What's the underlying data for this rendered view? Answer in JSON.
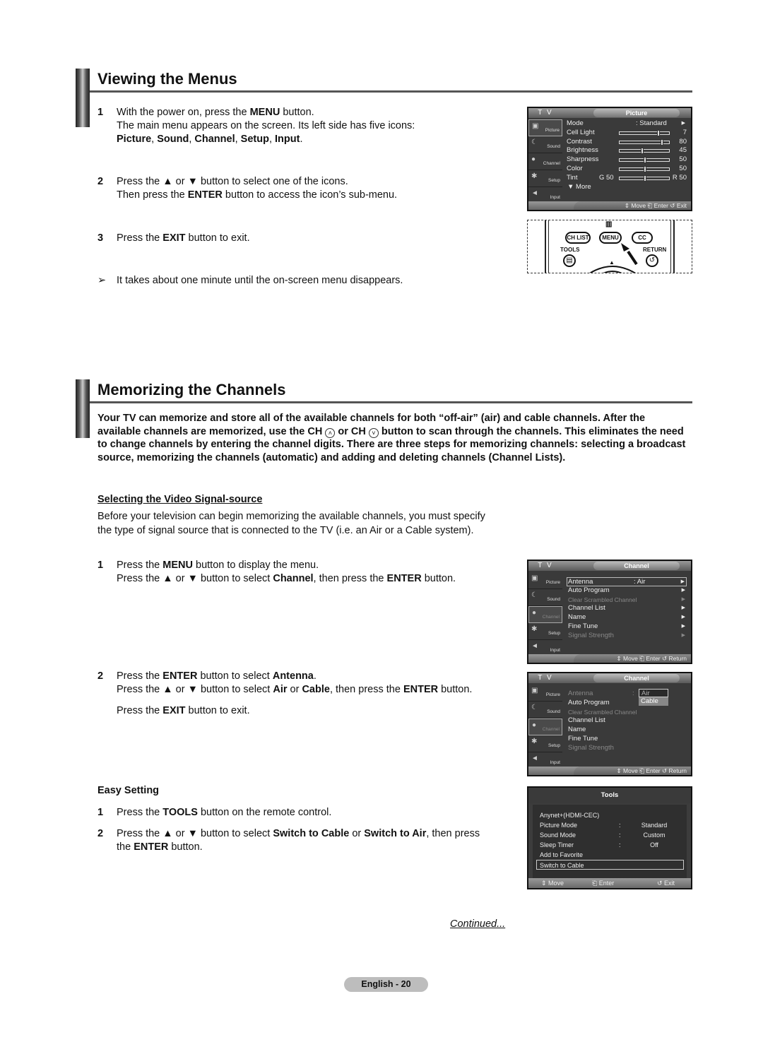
{
  "section1": {
    "title": "Viewing the Menus",
    "steps": [
      {
        "num": "1",
        "line1_pre": "With the power on, press the ",
        "line1_bold": "MENU",
        "line1_post": " button.",
        "line2": "The main menu appears on the screen. Its left side has five icons:",
        "line3_parts": [
          "Picture",
          ", ",
          "Sound",
          ", ",
          "Channel",
          ", ",
          "Setup",
          ", ",
          "Input",
          "."
        ]
      },
      {
        "num": "2",
        "line1": "Press the ▲ or ▼ button to select one of the icons.",
        "line2_pre": "Then press the ",
        "line2_bold": "ENTER",
        "line2_post": " button to access the icon’s sub-menu."
      },
      {
        "num": "3",
        "line1_pre": "Press the ",
        "line1_bold": "EXIT",
        "line1_post": " button to exit."
      }
    ],
    "note_icon": "➢",
    "note": "It takes about one minute until the on-screen menu disappears."
  },
  "picture_osd": {
    "tv_label": "T V",
    "header": "Picture",
    "sidebar": [
      "Picture",
      "Sound",
      "Channel",
      "Setup",
      "Input"
    ],
    "sidebar_icons": [
      "▣",
      "☾",
      "●",
      "✱",
      "◄"
    ],
    "mode": {
      "label": "Mode",
      "value": ": Standard",
      "arrow": "▶"
    },
    "sliders": [
      {
        "label": "Cell Light",
        "value": "7",
        "level": 0.79
      },
      {
        "label": "Contrast",
        "value": "80",
        "level": 0.85
      },
      {
        "label": "Brightness",
        "value": "45",
        "level": 0.45
      },
      {
        "label": "Sharpness",
        "value": "50",
        "level": 0.52
      },
      {
        "label": "Color",
        "value": "50",
        "level": 0.52
      }
    ],
    "tint": {
      "label": "Tint",
      "left": "G 50",
      "right": "R 50",
      "level": 0.52
    },
    "more": "▼ More",
    "footer": "⇕ Move   ⎗ Enter   ↺ Exit"
  },
  "remote": {
    "buttons": {
      "chlist": "CH LIST",
      "menu": "MENU",
      "cc": "CC"
    },
    "labels": {
      "tools": "TOOLS",
      "return": "RETURN"
    },
    "menu_icon": "▥",
    "tools_icon": "▤",
    "return_icon": "↺",
    "up_icon": "▲"
  },
  "section2": {
    "title": "Memorizing the Channels",
    "intro_parts": [
      "Your TV can memorize and store all of the available channels for both “off-air” (air) and cable channels. After the available channels are memorized, use the CH ",
      " or CH ",
      " button to scan through the channels. This eliminates the need to change channels by entering the channel digits. There are three steps for memorizing channels: selecting a broadcast source, memorizing the channels (automatic) and adding and deleting channels (Channel Lists)."
    ],
    "ch_up_icon": "˄",
    "ch_down_icon": "˅",
    "subsection": {
      "title": "Selecting the Video Signal-source",
      "para": "Before your television can begin memorizing the available channels, you must specify the type of signal source that is connected to the TV (i.e. an Air or a Cable system).",
      "step1": {
        "num": "1",
        "l1_pre": "Press the ",
        "l1_bold": "MENU",
        "l1_post": " button to display the menu.",
        "l2_pre": "Press the ▲ or ▼ button to select ",
        "l2_bold1": "Channel",
        "l2_mid": ", then press the ",
        "l2_bold2": "ENTER",
        "l2_post": " button."
      },
      "step2": {
        "num": "2",
        "l1_pre": "Press the ",
        "l1_bold1": "ENTER",
        "l1_mid": " button to select ",
        "l1_bold2": "Antenna",
        "l1_post": ".",
        "l2_pre": "Press the ▲ or ▼ button to select ",
        "l2_bold1": "Air",
        "l2_mid1": " or ",
        "l2_bold2": "Cable",
        "l2_mid2": ", then press the ",
        "l2_bold3": "ENTER",
        "l2_post": " button.",
        "l3_pre": "Press the ",
        "l3_bold": "EXIT",
        "l3_post": " button to exit."
      }
    },
    "easy": {
      "title": "Easy Setting",
      "step1": {
        "num": "1",
        "pre": "Press the ",
        "bold": "TOOLS",
        "post": " button on the remote control."
      },
      "step2": {
        "num": "2",
        "pre": "Press the ▲ or ▼ button to select ",
        "bold1": "Switch to Cable",
        "mid": " or ",
        "bold2": "Switch to Air",
        "post": ", then press",
        "l2_pre": "the ",
        "l2_bold": "ENTER",
        "l2_post": " button."
      }
    }
  },
  "channel_osd_1": {
    "tv_label": "T V",
    "header": "Channel",
    "sidebar": [
      "Picture",
      "Sound",
      "Channel",
      "Setup",
      "Input"
    ],
    "items": [
      {
        "label": "Antenna",
        "value": ": Air",
        "dim": false
      },
      {
        "label": "Auto Program",
        "dim": false
      },
      {
        "label": "Clear Scrambled Channel",
        "dim": true
      },
      {
        "label": "Channel List",
        "dim": false
      },
      {
        "label": "Name",
        "dim": false
      },
      {
        "label": "Fine Tune",
        "dim": false
      },
      {
        "label": "Signal Strength",
        "dim": true
      }
    ],
    "arrow": "▶",
    "footer": "⇕ Move   ⎗ Enter   ↺ Return"
  },
  "channel_osd_2": {
    "tv_label": "T V",
    "header": "Channel",
    "sidebar": [
      "Picture",
      "Sound",
      "Channel",
      "Setup",
      "Input"
    ],
    "items": [
      {
        "label": "Antenna",
        "dim": true
      },
      {
        "label": "Auto Program",
        "dim": false
      },
      {
        "label": "Clear Scrambled Channel",
        "dim": true
      },
      {
        "label": "Channel List",
        "dim": false
      },
      {
        "label": "Name",
        "dim": false
      },
      {
        "label": "Fine Tune",
        "dim": false
      },
      {
        "label": "Signal Strength",
        "dim": true
      }
    ],
    "colon": ":",
    "options": [
      "Air",
      "Cable"
    ],
    "footer": "⇕ Move   ⎗ Enter   ↺ Return"
  },
  "tools_osd": {
    "header": "Tools",
    "rows": [
      {
        "label": "Anynet+(HDMI-CEC)"
      },
      {
        "label": "Picture Mode",
        "colon": ":",
        "value": "Standard"
      },
      {
        "label": "Sound Mode",
        "colon": ":",
        "value": "Custom"
      },
      {
        "label": "Sleep Timer",
        "colon": ":",
        "value": "Off"
      },
      {
        "label": "Add to Favorite"
      },
      {
        "label": "Switch to Cable"
      }
    ],
    "footer": {
      "move": "⇕ Move",
      "enter": "⎗ Enter",
      "exit": "↺ Exit"
    }
  },
  "continued": "Continued...",
  "page_label": "English - 20"
}
